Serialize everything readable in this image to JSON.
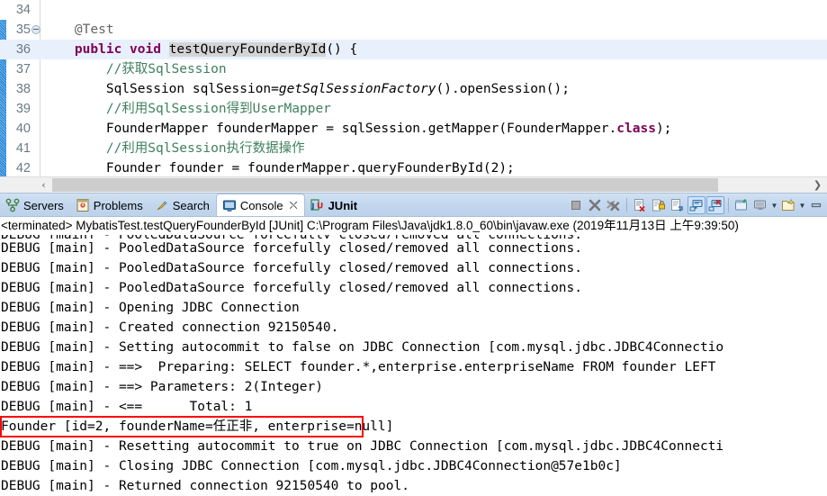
{
  "editor": {
    "lines": [
      {
        "num": "34",
        "fold": false,
        "highlight": false,
        "segments": []
      },
      {
        "num": "35",
        "fold": true,
        "highlight": false,
        "segments": [
          {
            "text": "    ",
            "cls": "plain"
          },
          {
            "text": "@Test",
            "cls": "annot"
          }
        ]
      },
      {
        "num": "36",
        "fold": false,
        "highlight": true,
        "segments": [
          {
            "text": "    ",
            "cls": "plain"
          },
          {
            "text": "public",
            "cls": "kw"
          },
          {
            "text": " ",
            "cls": "plain"
          },
          {
            "text": "void",
            "cls": "kw"
          },
          {
            "text": " ",
            "cls": "plain"
          },
          {
            "text": "testQueryFounderById",
            "cls": "occ"
          },
          {
            "text": "() {",
            "cls": "plain"
          }
        ]
      },
      {
        "num": "37",
        "fold": false,
        "highlight": false,
        "segments": [
          {
            "text": "        ",
            "cls": "plain"
          },
          {
            "text": "//获取SqlSession",
            "cls": "cmt"
          }
        ]
      },
      {
        "num": "38",
        "fold": false,
        "highlight": false,
        "segments": [
          {
            "text": "        SqlSession sqlSession=",
            "cls": "plain"
          },
          {
            "text": "getSqlSessionFactory",
            "cls": "stat"
          },
          {
            "text": "().openSession();",
            "cls": "plain"
          }
        ]
      },
      {
        "num": "39",
        "fold": false,
        "highlight": false,
        "segments": [
          {
            "text": "        ",
            "cls": "plain"
          },
          {
            "text": "//利用SqlSession得到UserMapper",
            "cls": "cmt"
          }
        ]
      },
      {
        "num": "40",
        "fold": false,
        "highlight": false,
        "segments": [
          {
            "text": "        FounderMapper founderMapper = sqlSession.getMapper(FounderMapper.",
            "cls": "plain"
          },
          {
            "text": "class",
            "cls": "kw"
          },
          {
            "text": ");",
            "cls": "plain"
          }
        ]
      },
      {
        "num": "41",
        "fold": false,
        "highlight": false,
        "segments": [
          {
            "text": "        ",
            "cls": "plain"
          },
          {
            "text": "//利用SqlSession执行数据操作",
            "cls": "cmt"
          }
        ]
      },
      {
        "num": "42",
        "fold": false,
        "highlight": false,
        "segments": [
          {
            "text": "        Founder founder = founderMapper.queryFounderById(2);",
            "cls": "plain"
          }
        ]
      }
    ],
    "hscroll": {
      "left_arrow": "‹",
      "right_arrow": "❯"
    }
  },
  "tabs": [
    {
      "label": "Servers",
      "icon": "servers-icon",
      "active": false,
      "bold": false,
      "closeable": false
    },
    {
      "label": "Problems",
      "icon": "problems-icon",
      "active": false,
      "bold": false,
      "closeable": false
    },
    {
      "label": "Search",
      "icon": "search-icon",
      "active": false,
      "bold": false,
      "closeable": false
    },
    {
      "label": "Console",
      "icon": "console-icon",
      "active": true,
      "bold": false,
      "closeable": true,
      "close_glyph": "⛌"
    },
    {
      "label": "JUnit",
      "icon": "junit-icon",
      "active": false,
      "bold": true,
      "closeable": false
    }
  ],
  "toolbar": {
    "buttons": [
      {
        "name": "terminate-button",
        "title": "Terminate"
      },
      {
        "name": "remove-launch-button",
        "title": "Remove Launch"
      },
      {
        "name": "remove-all-terminated-button",
        "title": "Remove All Terminated Launches"
      },
      {
        "name": "clear-console-button",
        "title": "Clear Console"
      },
      {
        "name": "scroll-lock-button",
        "title": "Scroll Lock"
      },
      {
        "name": "word-wrap-button",
        "title": "Word Wrap"
      },
      {
        "name": "show-console-on-output-button",
        "title": "Show Console When Standard Out Changes",
        "pressed": true
      },
      {
        "name": "show-console-on-error-button",
        "title": "Show Console When Standard Error Changes",
        "pressed": true
      },
      {
        "name": "pin-console-button",
        "title": "Pin Console"
      },
      {
        "name": "display-selected-console-button",
        "title": "Display Selected Console"
      },
      {
        "name": "open-console-button",
        "title": "Open Console"
      },
      {
        "name": "minimize-button",
        "title": "Minimize"
      }
    ]
  },
  "console": {
    "header": "<terminated> MybatisTest.testQueryFounderById [JUnit] C:\\Program Files\\Java\\jdk1.8.0_60\\bin\\javaw.exe (2019年11月13日 上午9:39:50)",
    "lines": [
      "DEBUG [main] - PooledDataSource forcefully closed/removed all connections.",
      "DEBUG [main] - PooledDataSource forcefully closed/removed all connections.",
      "DEBUG [main] - PooledDataSource forcefully closed/removed all connections.",
      "DEBUG [main] - Opening JDBC Connection",
      "DEBUG [main] - Created connection 92150540.",
      "DEBUG [main] - Setting autocommit to false on JDBC Connection [com.mysql.jdbc.JDBC4Connectio",
      "DEBUG [main] - ==>  Preparing: SELECT founder.*,enterprise.enterpriseName FROM founder LEFT ",
      "DEBUG [main] - ==> Parameters: 2(Integer)",
      "DEBUG [main] - <==      Total: 1",
      "Founder [id=2, founderName=任正非, enterprise=null]",
      "DEBUG [main] - Resetting autocommit to true on JDBC Connection [com.mysql.jdbc.JDBC4Connecti",
      "DEBUG [main] - Closing JDBC Connection [com.mysql.jdbc.JDBC4Connection@57e1b0c]",
      "DEBUG [main] - Returned connection 92150540 to pool."
    ],
    "highlight_box": {
      "line_index": 9,
      "color": "#fb0303"
    }
  },
  "colors": {
    "keyword": "#7f0055",
    "comment": "#3f7f5f",
    "annotation": "#646464",
    "highlight_line": "#e8f0fc",
    "occurrence": "#d4d4d4",
    "tabbar": "#c3d7ee",
    "red_box": "#fb0303"
  }
}
